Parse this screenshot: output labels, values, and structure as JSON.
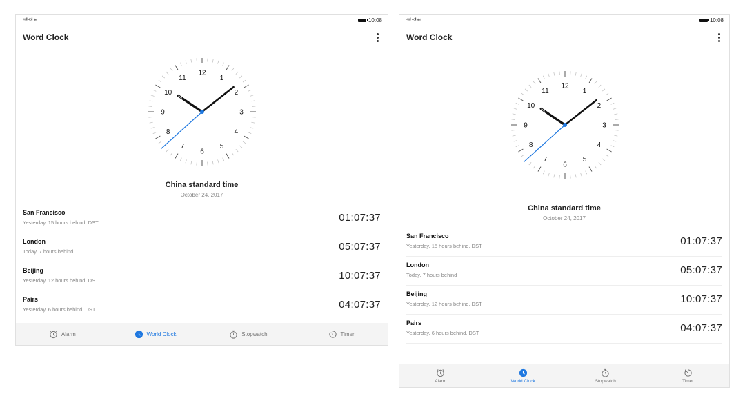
{
  "status": {
    "signal": "⁴⁶ᴵᴵ ⁴⁶ᴵᴵ ≋",
    "time": "10:08"
  },
  "app": {
    "title": "Word Clock",
    "menu_icon": "more-vert-icon"
  },
  "clock": {
    "hour_labels": [
      "12",
      "1",
      "2",
      "3",
      "4",
      "5",
      "6",
      "7",
      "8",
      "9",
      "10",
      "11"
    ],
    "hour": 10,
    "minute": 8,
    "second": 38,
    "hand_color": "#111111",
    "second_hand_color": "#1f78e0"
  },
  "zone": {
    "title": "China standard time",
    "date": "October 24, 2017"
  },
  "cities": [
    {
      "name": "San Francisco",
      "desc": "Yesterday, 15 hours behind, DST",
      "time": "01:07:37"
    },
    {
      "name": "London",
      "desc": "Today, 7 hours behind",
      "time": "05:07:37"
    },
    {
      "name": "Beijing",
      "desc": "Yesterday, 12 hours behind, DST",
      "time": "10:07:37"
    },
    {
      "name": "Pairs",
      "desc": "Yesterday, 6 hours behind, DST",
      "time": "04:07:37"
    }
  ],
  "tabs": [
    {
      "label": "Alarm",
      "icon": "alarm-clock-icon"
    },
    {
      "label": "World Clock",
      "icon": "world-clock-icon",
      "active": true
    },
    {
      "label": "Stopwatch",
      "icon": "stopwatch-icon"
    },
    {
      "label": "Timer",
      "icon": "timer-icon"
    }
  ],
  "colors": {
    "accent": "#1f78e0",
    "tabbar_bg": "#f4f4f4",
    "secondary_text": "#888888"
  }
}
